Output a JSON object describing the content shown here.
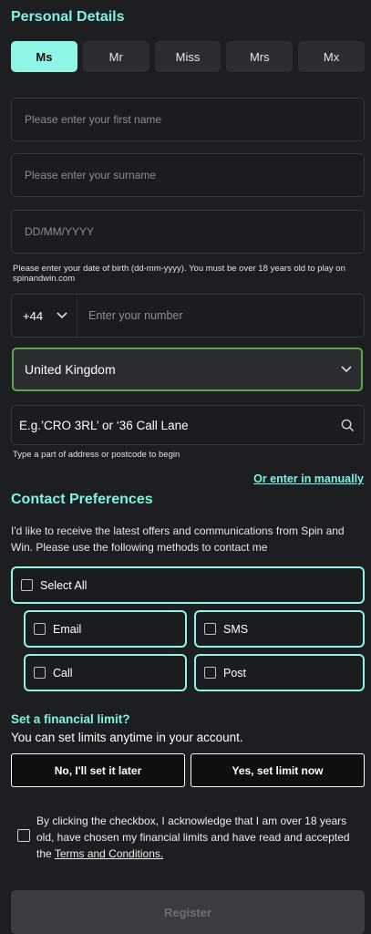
{
  "personal": {
    "heading": "Personal Details",
    "titles": [
      "Ms",
      "Mr",
      "Miss",
      "Mrs",
      "Mx"
    ],
    "first_name_placeholder": "Please enter your first name",
    "surname_placeholder": "Please enter your surname",
    "dob_placeholder": "DD/MM/YYYY",
    "dob_hint": "Please enter your date of birth (dd-mm-yyyy). You must be over 18 years old to play on spinandwin.com",
    "phone_code": "+44",
    "phone_placeholder": "Enter your number",
    "country": "United Kingdom",
    "address_placeholder": "E.g.’CRO 3RL’ or ‘36 Call Lane",
    "address_hint": "Type a part of address or postcode to begin",
    "manual_link": "Or enter in manually"
  },
  "contact": {
    "heading": "Contact Preferences",
    "description": "I'd like to receive the latest offers and communications from Spin and Win. Please use the following methods to contact me",
    "select_all": "Select All",
    "email": "Email",
    "sms": "SMS",
    "call": "Call",
    "post": "Post"
  },
  "financial": {
    "heading": "Set a financial limit?",
    "subtext": "You can set limits anytime in your account.",
    "later_button": "No, I'll set it later",
    "now_button": "Yes, set limit now"
  },
  "consent": {
    "text_before": "By clicking the checkbox, I acknowledge that I am over 18 years old, have chosen my financial limits and have read and accepted the ",
    "terms_link": "Terms and Conditions."
  },
  "register_button": "Register",
  "colors": {
    "accent": "#8ff5e5",
    "heading": "#7ff2e0",
    "country_border": "#5fa84a",
    "background": "#1c1e21"
  }
}
